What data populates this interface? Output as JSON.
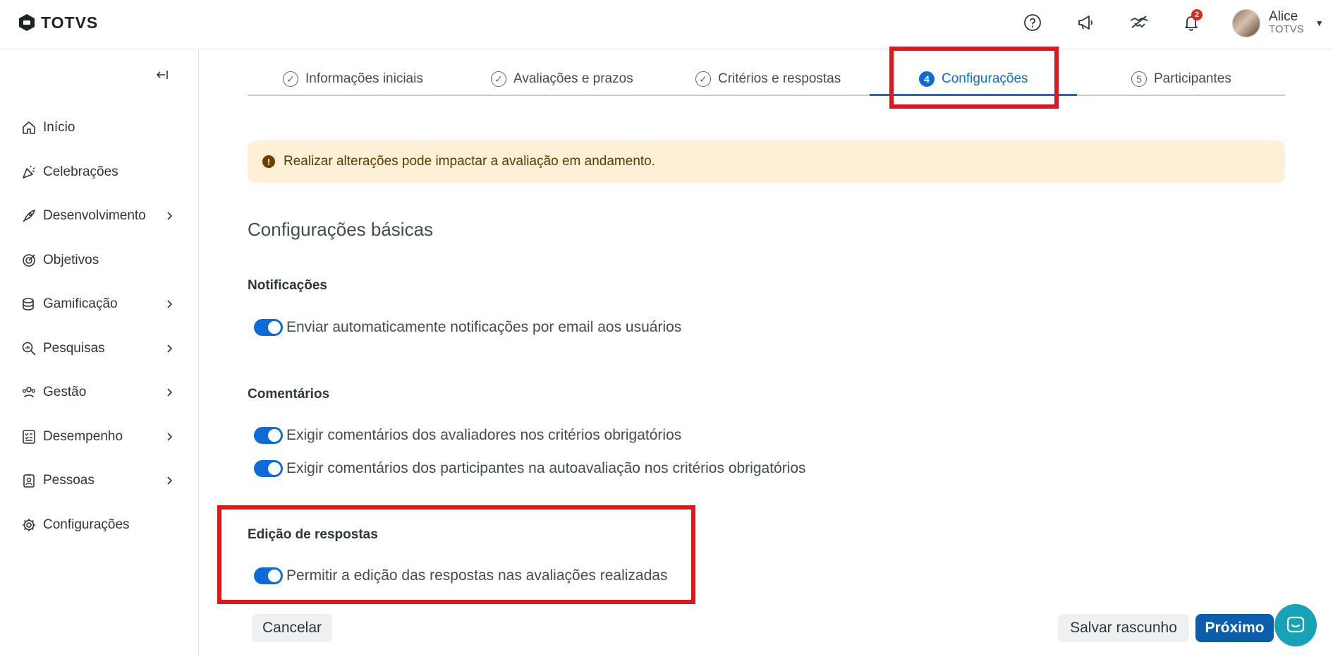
{
  "header": {
    "logo_text": "TOTVS",
    "notifications_count": "2",
    "user": {
      "name": "Alice",
      "org": "TOTVS"
    }
  },
  "sidebar": {
    "items": [
      {
        "label": "Início",
        "icon": "home-icon",
        "has_children": false
      },
      {
        "label": "Celebrações",
        "icon": "party-icon",
        "has_children": false
      },
      {
        "label": "Desenvolvimento",
        "icon": "rocket-icon",
        "has_children": true
      },
      {
        "label": "Objetivos",
        "icon": "target-icon",
        "has_children": false
      },
      {
        "label": "Gamificação",
        "icon": "coins-icon",
        "has_children": true
      },
      {
        "label": "Pesquisas",
        "icon": "search-chart-icon",
        "has_children": true
      },
      {
        "label": "Gestão",
        "icon": "people-icon",
        "has_children": true
      },
      {
        "label": "Desempenho",
        "icon": "checklist-icon",
        "has_children": true
      },
      {
        "label": "Pessoas",
        "icon": "badge-icon",
        "has_children": true
      },
      {
        "label": "Configurações",
        "icon": "gear-icon",
        "has_children": false
      }
    ]
  },
  "stepper": {
    "steps": [
      {
        "label": "Informações iniciais",
        "marker": "check",
        "state": "done"
      },
      {
        "label": "Avaliações e prazos",
        "marker": "check",
        "state": "done"
      },
      {
        "label": "Critérios e respostas",
        "marker": "check",
        "state": "done"
      },
      {
        "label": "Configurações",
        "marker": "4",
        "state": "active"
      },
      {
        "label": "Participantes",
        "marker": "5",
        "state": "pending"
      }
    ]
  },
  "alert": {
    "text": "Realizar alterações pode impactar a avaliação em andamento."
  },
  "content": {
    "section_title": "Configurações básicas",
    "groups": [
      {
        "title": "Notificações",
        "options": [
          {
            "label": "Enviar automaticamente notificações por email aos usuários",
            "checked": true
          }
        ]
      },
      {
        "title": "Comentários",
        "options": [
          {
            "label": "Exigir comentários dos avaliadores nos critérios obrigatórios",
            "checked": true
          },
          {
            "label": "Exigir comentários dos participantes na autoavaliação nos critérios obrigatórios",
            "checked": true
          }
        ]
      },
      {
        "title": "Edição de respostas",
        "options": [
          {
            "label": "Permitir a edição das respostas nas avaliações realizadas",
            "checked": true
          }
        ]
      }
    ]
  },
  "footer": {
    "cancel_label": "Cancelar",
    "save_draft_label": "Salvar rascunho",
    "next_label": "Próximo"
  },
  "colors": {
    "primary": "#0c6bd7",
    "primary_button": "#0b5eab",
    "alert_bg": "#fef0d6",
    "highlight": "#e0161c",
    "chat": "#17a2b8"
  }
}
